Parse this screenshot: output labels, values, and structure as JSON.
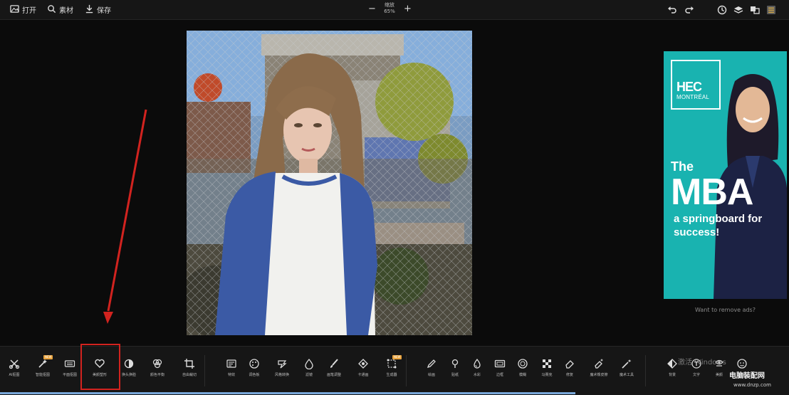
{
  "topbar": {
    "open_label": "打开",
    "search_label": "素材",
    "save_label": "保存",
    "zoom_title": "缩放",
    "zoom_value": "65%",
    "zoom_minus": "−",
    "zoom_plus": "+",
    "icons": [
      "undo-icon",
      "redo-icon",
      "history-icon",
      "layers-icon",
      "compare-icon",
      "menu-icon"
    ]
  },
  "ad": {
    "logo_line1": "HEC",
    "logo_line2": "MONTRÉAL",
    "headline_small": "The",
    "headline_big": "MBA",
    "tagline": "a springboard for success!",
    "remove_text": "Want to remove ads?"
  },
  "toolbar": {
    "tools": [
      {
        "label": "AI抠图",
        "icon": "scissors-icon"
      },
      {
        "label": "智能抠图",
        "icon": "magic-cut-icon",
        "badge": "NEW"
      },
      {
        "label": "平面抠图",
        "icon": "keyboard-icon"
      },
      {
        "label": "美颜塑形",
        "icon": "heart-icon"
      },
      {
        "label": "换头换脸",
        "icon": "face-swap-icon"
      },
      {
        "label": "颜色平衡",
        "icon": "color-balance-icon"
      },
      {
        "label": "自由裁切",
        "icon": "crop-icon"
      },
      {
        "label": "特效",
        "icon": "effects-icon"
      },
      {
        "label": "调色板",
        "icon": "palette-icon"
      },
      {
        "label": "风格转换",
        "icon": "style-icon"
      },
      {
        "label": "滤镜",
        "icon": "drop-icon"
      },
      {
        "label": "画笔调整",
        "icon": "brush-icon"
      },
      {
        "label": "卡通画",
        "icon": "cartoon-icon"
      },
      {
        "label": "生成器",
        "icon": "generator-icon",
        "badge": "NEW"
      },
      {
        "label": "绘画",
        "icon": "pencil-icon"
      },
      {
        "label": "贴纸",
        "icon": "pin-icon"
      },
      {
        "label": "水彩",
        "icon": "water-icon"
      },
      {
        "label": "边框",
        "icon": "frame-icon"
      },
      {
        "label": "模糊",
        "icon": "blur-icon"
      },
      {
        "label": "马赛克",
        "icon": "mosaic-icon"
      },
      {
        "label": "修复",
        "icon": "eraser-icon"
      },
      {
        "label": "魔术橡皮擦",
        "icon": "magic-eraser-icon"
      },
      {
        "label": "魔术工具",
        "icon": "magic-wand-icon"
      },
      {
        "label": "背景",
        "icon": "background-icon"
      },
      {
        "label": "文字",
        "icon": "text-icon"
      },
      {
        "label": "美颜",
        "icon": "beauty-icon"
      },
      {
        "label": "贴图",
        "icon": "sticker-icon"
      }
    ],
    "watermark": "激活 Windows",
    "site_name": "电脑装配网",
    "site_url": "www.dnzp.com"
  },
  "colors": {
    "background": "#0b0b0b",
    "bar": "#161616",
    "highlight": "#d2231f",
    "ad_bg": "#19b3b0",
    "progress": "#79a7d9"
  }
}
